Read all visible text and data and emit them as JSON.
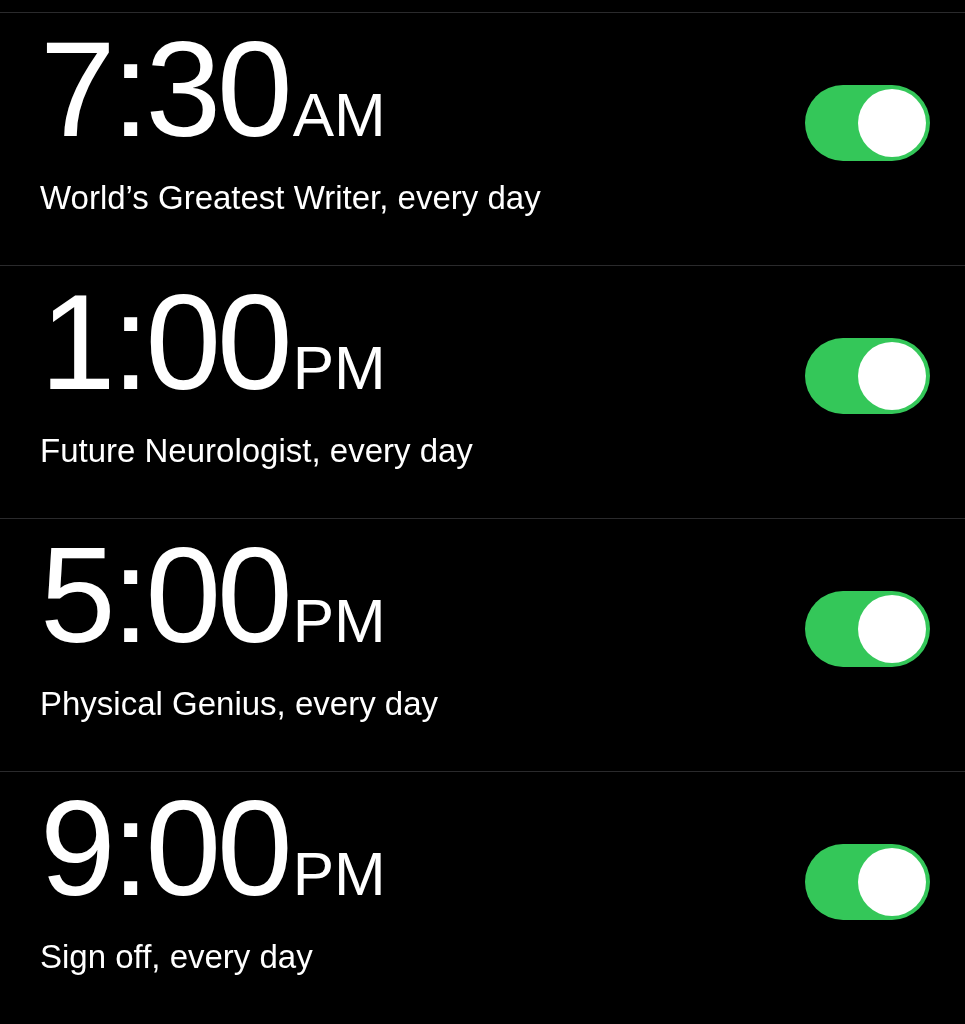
{
  "alarms": [
    {
      "time": "7:30",
      "period": "AM",
      "label": "World’s Greatest Writer, every day",
      "on": true
    },
    {
      "time": "1:00",
      "period": "PM",
      "label": "Future Neurologist, every day",
      "on": true
    },
    {
      "time": "5:00",
      "period": "PM",
      "label": "Physical Genius, every day",
      "on": true
    },
    {
      "time": "9:00",
      "period": "PM",
      "label": "Sign off, every day",
      "on": true
    }
  ]
}
